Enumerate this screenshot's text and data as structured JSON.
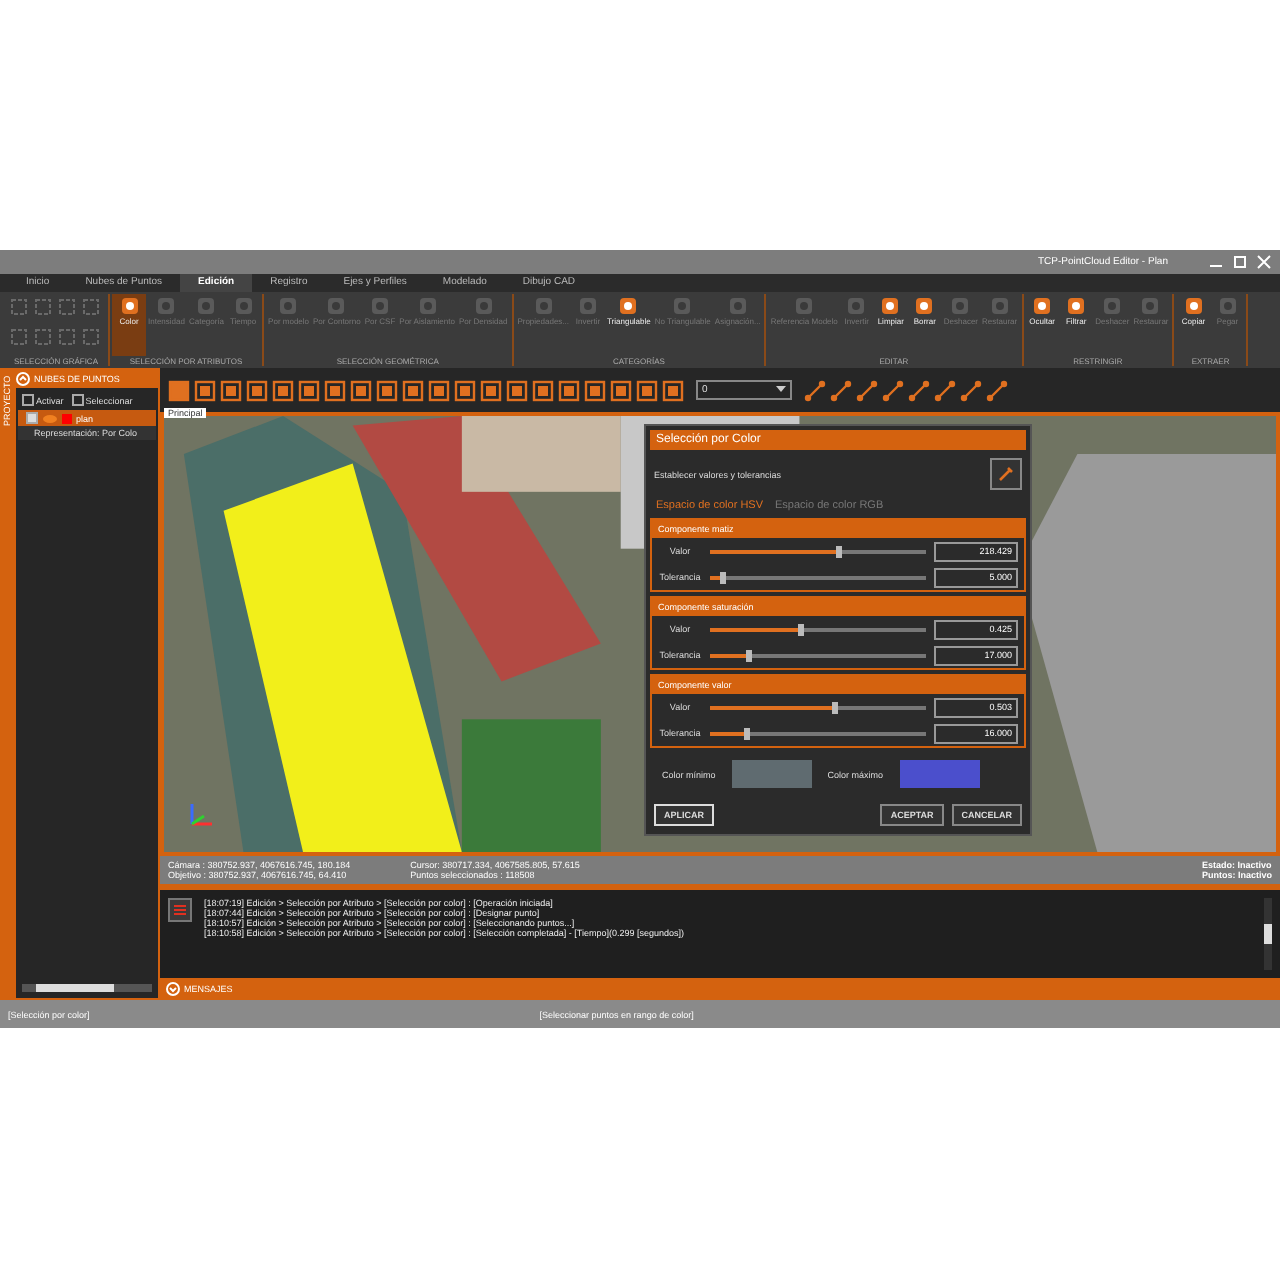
{
  "window": {
    "title": "TCP-PointCloud Editor - Plan"
  },
  "tabs": [
    {
      "label": "Inicio",
      "selected": false
    },
    {
      "label": "Nubes de Puntos",
      "selected": false
    },
    {
      "label": "Edición",
      "selected": true
    },
    {
      "label": "Registro",
      "selected": false
    },
    {
      "label": "Ejes y Perfiles",
      "selected": false
    },
    {
      "label": "Modelado",
      "selected": false
    },
    {
      "label": "Dibujo CAD",
      "selected": false
    }
  ],
  "ribbon": [
    {
      "label": "SELECCIÓN GRÁFICA",
      "kind": "grid"
    },
    {
      "label": "SELECCIÓN POR ATRIBUTOS",
      "kind": "buttons",
      "buttons": [
        {
          "label": "Color",
          "disabled": false,
          "active": true
        },
        {
          "label": "Intensidad",
          "disabled": true,
          "active": false
        },
        {
          "label": "Categoría",
          "disabled": true,
          "active": false
        },
        {
          "label": "Tiempo",
          "disabled": true,
          "active": false
        }
      ]
    },
    {
      "label": "SELECCIÓN GEOMÉTRICA",
      "kind": "buttons",
      "buttons": [
        {
          "label": "Por modelo",
          "disabled": true,
          "active": false
        },
        {
          "label": "Por Contorno",
          "disabled": true,
          "active": false
        },
        {
          "label": "Por CSF",
          "disabled": true,
          "active": false
        },
        {
          "label": "Por Aislamiento",
          "disabled": true,
          "active": false
        },
        {
          "label": "Por Densidad",
          "disabled": true,
          "active": false
        }
      ]
    },
    {
      "label": "CATEGORÍAS",
      "kind": "buttons",
      "buttons": [
        {
          "label": "Propiedades...",
          "disabled": true,
          "active": false
        },
        {
          "label": "Invertir",
          "disabled": true,
          "active": false
        },
        {
          "label": "Triangulable",
          "disabled": false,
          "active": false
        },
        {
          "label": "No Triangulable",
          "disabled": true,
          "active": false
        },
        {
          "label": "Asignación...",
          "disabled": true,
          "active": false
        }
      ]
    },
    {
      "label": "EDITAR",
      "kind": "buttons",
      "buttons": [
        {
          "label": "Referencia Modelo",
          "disabled": true,
          "active": false
        },
        {
          "label": "Invertir",
          "disabled": true,
          "active": false
        },
        {
          "label": "Limpiar",
          "disabled": false,
          "active": false
        },
        {
          "label": "Borrar",
          "disabled": false,
          "active": false
        },
        {
          "label": "Deshacer",
          "disabled": true,
          "active": false
        },
        {
          "label": "Restaurar",
          "disabled": true,
          "active": false
        }
      ]
    },
    {
      "label": "RESTRINGIR",
      "kind": "buttons",
      "buttons": [
        {
          "label": "Ocultar",
          "disabled": false,
          "active": false
        },
        {
          "label": "Filtrar",
          "disabled": false,
          "active": false
        },
        {
          "label": "Deshacer",
          "disabled": true,
          "active": false
        },
        {
          "label": "Restaurar",
          "disabled": true,
          "active": false
        }
      ]
    },
    {
      "label": "EXTRAER",
      "kind": "buttons",
      "buttons": [
        {
          "label": "Copiar",
          "disabled": false,
          "active": false
        },
        {
          "label": "Pegar",
          "disabled": true,
          "active": false
        }
      ]
    }
  ],
  "sidebar": {
    "tab": "PROYECTO",
    "header": "NUBES DE PUNTOS",
    "options": [
      {
        "label": "Activar",
        "checked": false
      },
      {
        "label": "Seleccionar",
        "checked": false
      }
    ],
    "tree": [
      {
        "label": "plan",
        "checked": true,
        "selected": true,
        "children": [
          {
            "label": "Representación: Por Colo"
          }
        ]
      }
    ]
  },
  "toolbar": {
    "tooltip": "Principal",
    "dropdown": "0"
  },
  "dialog": {
    "title": "Selección por Color",
    "subtitle": "Establecer valores y tolerancias",
    "tabs": [
      {
        "label": "Espacio de color HSV",
        "selected": true
      },
      {
        "label": "Espacio de color RGB",
        "selected": false
      }
    ],
    "sections": [
      {
        "title": "Componente matiz",
        "rows": [
          {
            "label": "Valor",
            "level": 0.6,
            "value": "218.429"
          },
          {
            "label": "Tolerancia",
            "level": 0.06,
            "value": "5.000"
          }
        ]
      },
      {
        "title": "Componente saturación",
        "rows": [
          {
            "label": "Valor",
            "level": 0.42,
            "value": "0.425"
          },
          {
            "label": "Tolerancia",
            "level": 0.18,
            "value": "17.000"
          }
        ]
      },
      {
        "title": "Componente valor",
        "rows": [
          {
            "label": "Valor",
            "level": 0.58,
            "value": "0.503"
          },
          {
            "label": "Tolerancia",
            "level": 0.17,
            "value": "16.000"
          }
        ]
      }
    ],
    "swatches": [
      {
        "label": "Color mínimo",
        "color": "#5f6b70"
      },
      {
        "label": "Color máximo",
        "color": "#4b4fcc"
      }
    ],
    "buttons": [
      "APLICAR",
      "ACEPTAR",
      "CANCELAR"
    ]
  },
  "viewport_status": {
    "left": [
      "Cámara : 380752.937, 4067616.745, 180.184",
      "Objetivo : 380752.937, 4067616.745, 64.410"
    ],
    "middle": [
      "Cursor: 380717.334, 4067585.805, 57.615",
      "Puntos seleccionados : 118508"
    ],
    "right": [
      "Estado: Inactivo",
      "Puntos: Inactivo"
    ]
  },
  "log": [
    "[18:07:19] Edición > Selección por Atributo > [Selección por color] : [Operación iniciada]",
    "[18:07:44] Edición > Selección por Atributo > [Selección por color] : [Designar punto]",
    "[18:10:57] Edición > Selección por Atributo > [Selección por color] : [Seleccionando puntos...]",
    "[18:10:58] Edición > Selección por Atributo > [Selección por color] : [Selección completada] - [Tiempo](0.299 [segundos])"
  ],
  "messages_label": "MENSAJES",
  "status_bar": [
    "[Selección por color]",
    "[Seleccionar puntos en rango de color]"
  ]
}
